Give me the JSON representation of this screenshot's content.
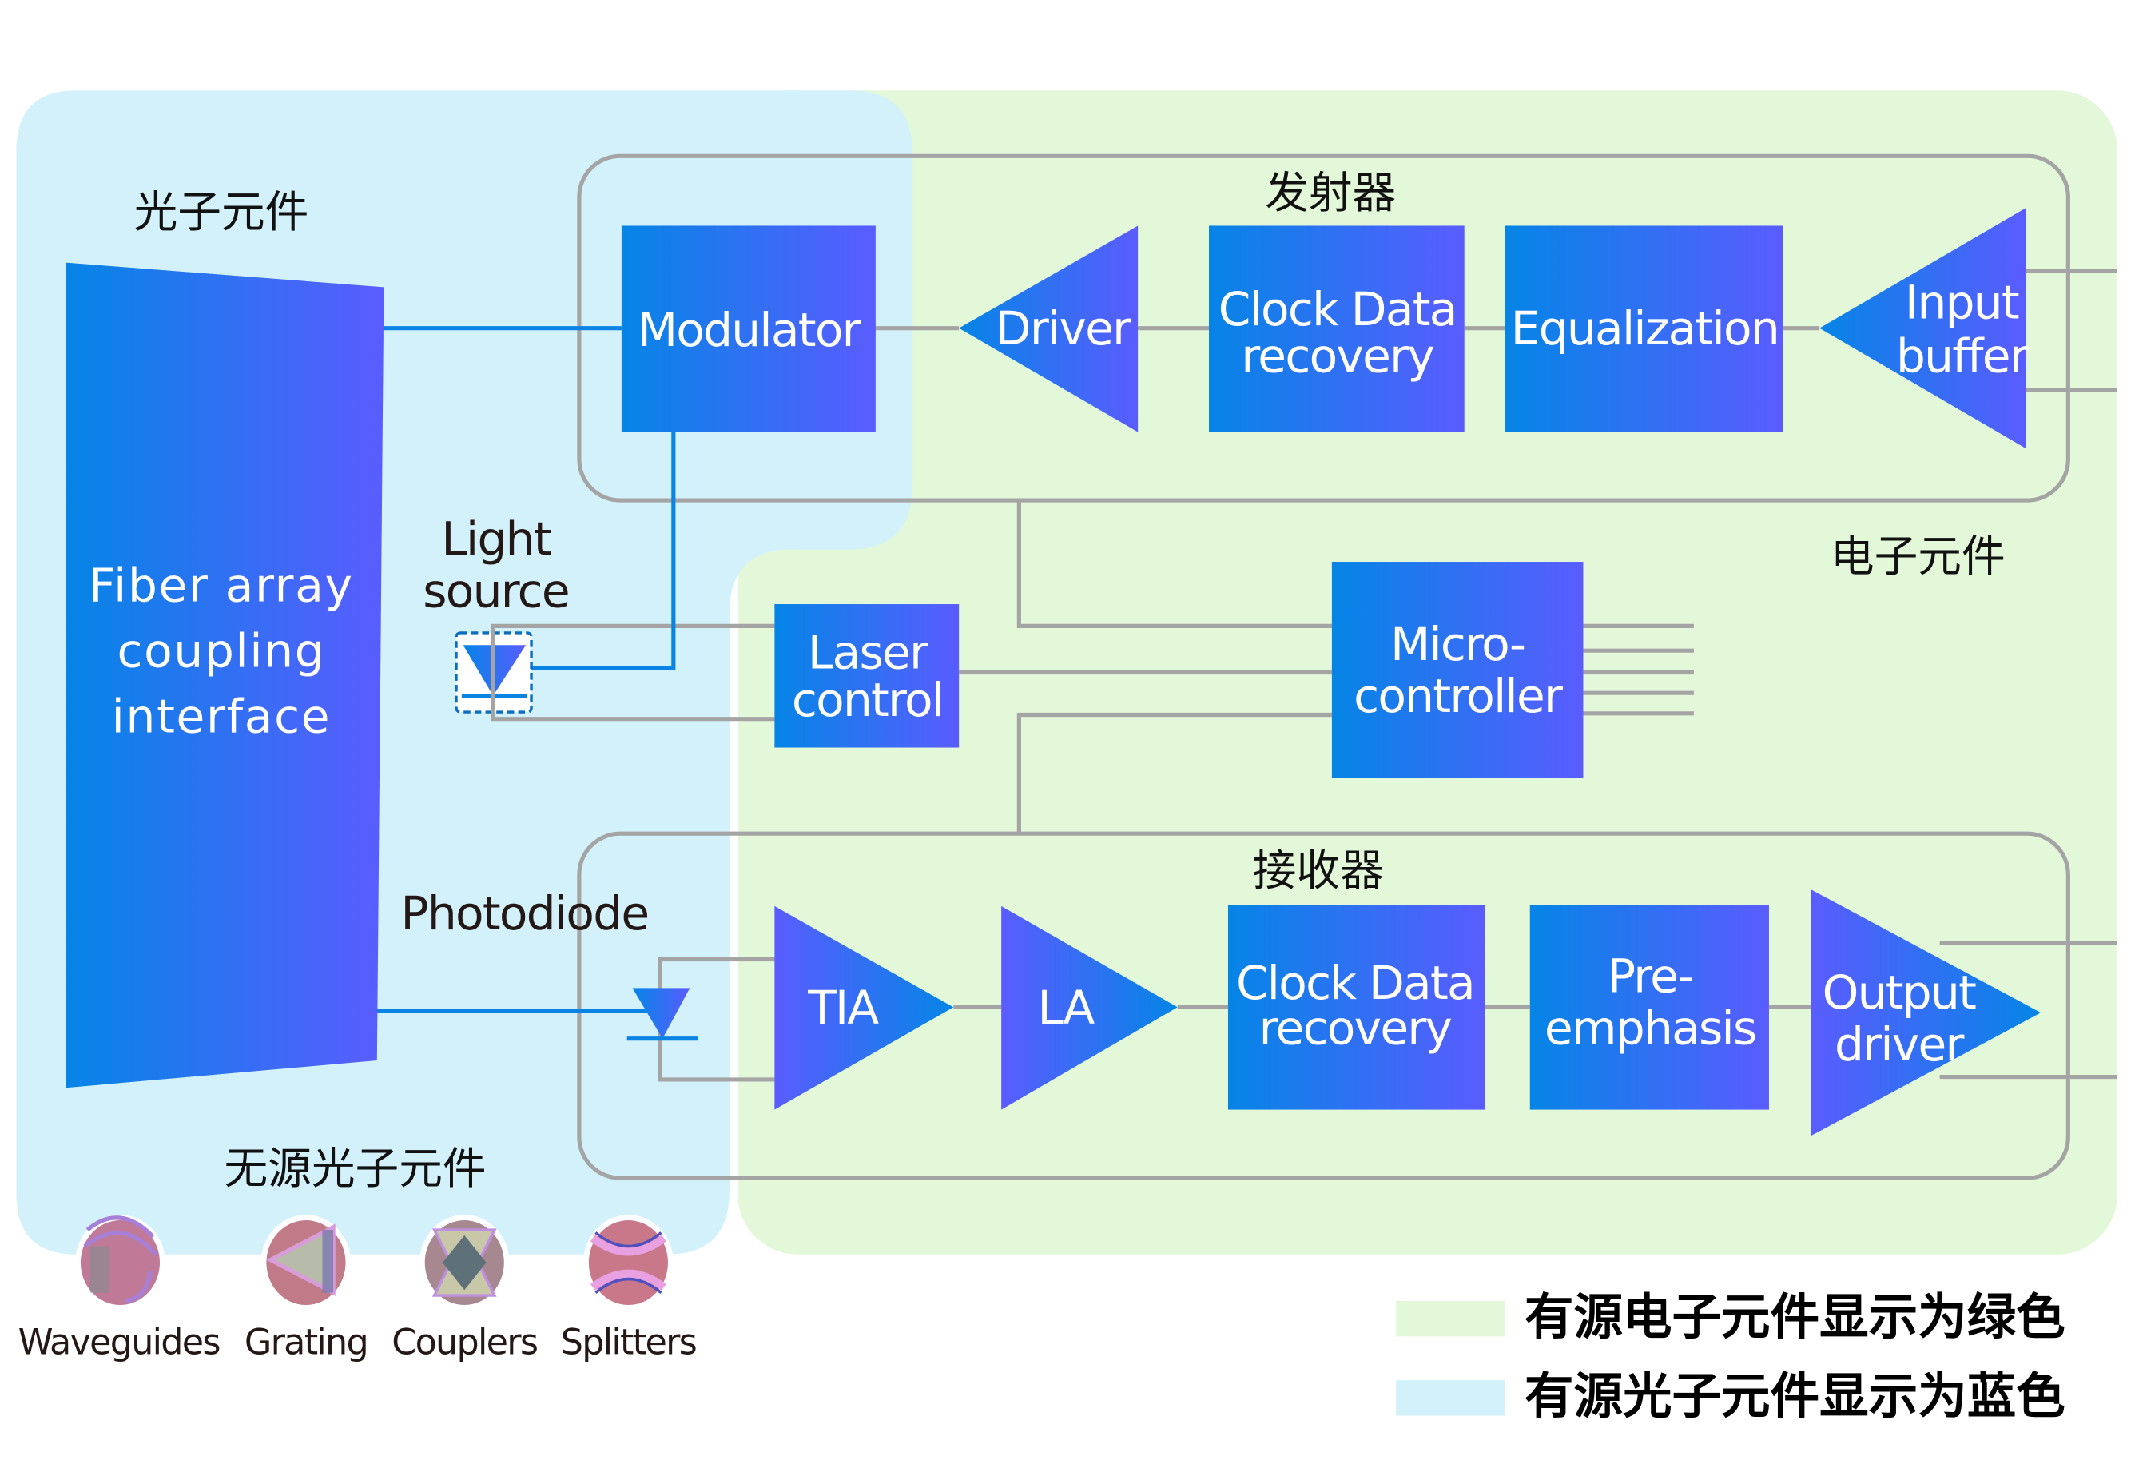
{
  "colors": {
    "electronic_bg": "#e3f7d9",
    "photonic_bg": "#d2f1fa",
    "block_start": "#0585e6",
    "block_end": "#5a5cff",
    "wire": "#a4a4a4",
    "optical_wire": "#0a84e4"
  },
  "regions": {
    "photonic_label": "光子元件",
    "electronic_label": "电子元件",
    "passive_label": "无源光子元件"
  },
  "transmitter": {
    "title": "发射器",
    "blocks": {
      "modulator": "Modulator",
      "driver": "Driver",
      "cdr_line1": "Clock Data",
      "cdr_line2": "recovery",
      "equalization": "Equalization",
      "input_buffer_line1": "Input",
      "input_buffer_line2": "buffer"
    }
  },
  "receiver": {
    "title": "接收器",
    "blocks": {
      "tia": "TIA",
      "la": "LA",
      "cdr_line1": "Clock Data",
      "cdr_line2": "recovery",
      "preemphasis_line1": "Pre-",
      "preemphasis_line2": "emphasis",
      "output_driver_line1": "Output",
      "output_driver_line2": "driver"
    }
  },
  "fiber_array": {
    "line1": "Fiber array",
    "line2": "coupling",
    "line3": "interface"
  },
  "light_source": {
    "line1": "Light",
    "line2": "source",
    "icon": "laser-diode-icon"
  },
  "photodiode": {
    "label": "Photodiode",
    "icon": "photodiode-icon"
  },
  "laser_control": {
    "line1": "Laser",
    "line2": "control"
  },
  "microcontroller": {
    "line1": "Micro-",
    "line2": "controller"
  },
  "passive_components": [
    {
      "label": "Waveguides",
      "icon": "waveguide-icon"
    },
    {
      "label": "Grating",
      "icon": "grating-icon"
    },
    {
      "label": "Couplers",
      "icon": "coupler-icon"
    },
    {
      "label": "Splitters",
      "icon": "splitter-icon"
    }
  ],
  "legend": [
    {
      "label": "有源电子元件显示为绿色",
      "color": "#e3f7d9"
    },
    {
      "label": "有源光子元件显示为蓝色",
      "color": "#d2f1fa"
    }
  ]
}
